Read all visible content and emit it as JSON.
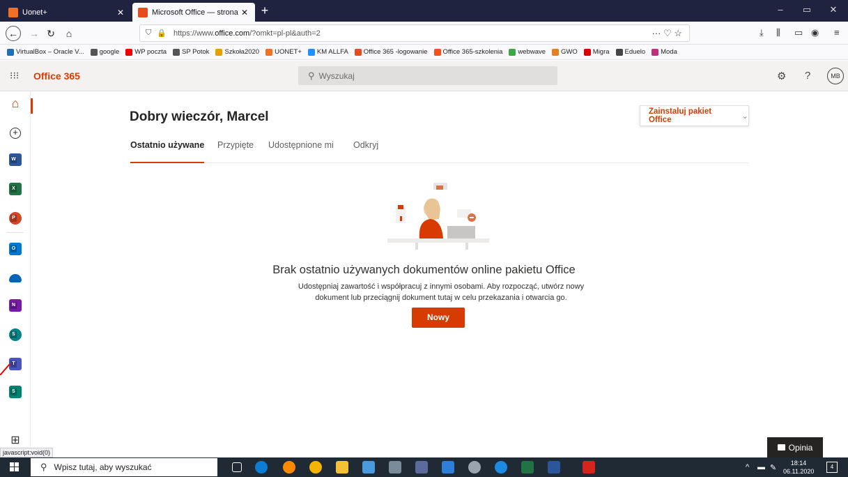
{
  "browser": {
    "tabs": [
      {
        "title": "Uonet+",
        "close": "✕"
      },
      {
        "title": "Microsoft Office — strona głów",
        "close": "✕"
      }
    ],
    "new_tab": "+",
    "window_controls": [
      "–",
      "▭",
      "✕"
    ],
    "url_prefix": "https://www.",
    "url_host": "office.com",
    "url_suffix": "/?omkt=pl-pl&auth=2",
    "url_icons": "··· ♡ ☆"
  },
  "bookmarks": [
    {
      "label": "VirtualBox – Oracle V...",
      "color": "#1d6fb8"
    },
    {
      "label": "google",
      "color": "#555"
    },
    {
      "label": "WP poczta",
      "color": "#e00"
    },
    {
      "label": "SP Potok",
      "color": "#555"
    },
    {
      "label": "Szkoła2020",
      "color": "#e8a000"
    },
    {
      "label": "UONET+",
      "color": "#f36f21"
    },
    {
      "label": "KM ALLFA",
      "color": "#1e90ff"
    },
    {
      "label": "Office 365 -logowanie",
      "color": "#e74c1c"
    },
    {
      "label": "Office 365-szkolenia",
      "color": "#f1511b"
    },
    {
      "label": "webwave",
      "color": "#3ca843"
    },
    {
      "label": "GWO",
      "color": "#e67e22"
    },
    {
      "label": "Migra",
      "color": "#d00"
    },
    {
      "label": "Eduelo",
      "color": "#444"
    },
    {
      "label": "Moda",
      "color": "#c0307a"
    }
  ],
  "office": {
    "brand": "Office 365",
    "search_placeholder": "Wyszukaj",
    "avatar": "MB",
    "greeting": "Dobry wieczór, Marcel",
    "install_label": "Zainstaluj pakiet Office",
    "tabs": [
      "Ostatnio używane",
      "Przypięte",
      "Udostępnione mi",
      "Odkryj"
    ],
    "empty_title": "Brak ostatnio używanych dokumentów online pakietu Office",
    "empty_text": "Udostępniaj zawartość i współpracuj z innymi osobami. Aby rozpocząć, utwórz nowy dokument lub przeciągnij dokument tutaj w celu przekazania i otwarcia go.",
    "new_button": "Nowy",
    "feedback": "Opinia"
  },
  "status_text": "javascript:void(0)",
  "taskbar": {
    "search_placeholder": "Wpisz tutaj, aby wyszukać",
    "time": "18:14",
    "date": "06.11.2020",
    "notifications": "4"
  },
  "colors": {
    "accent": "#d83b01",
    "word": "#2b579a",
    "excel": "#217346",
    "powerpoint": "#d24726",
    "outlook": "#0078d4",
    "onedrive": "#0364b8",
    "onenote": "#7719aa",
    "sharepoint": "#038387",
    "teams": "#4b53bc",
    "sway": "#008272"
  }
}
